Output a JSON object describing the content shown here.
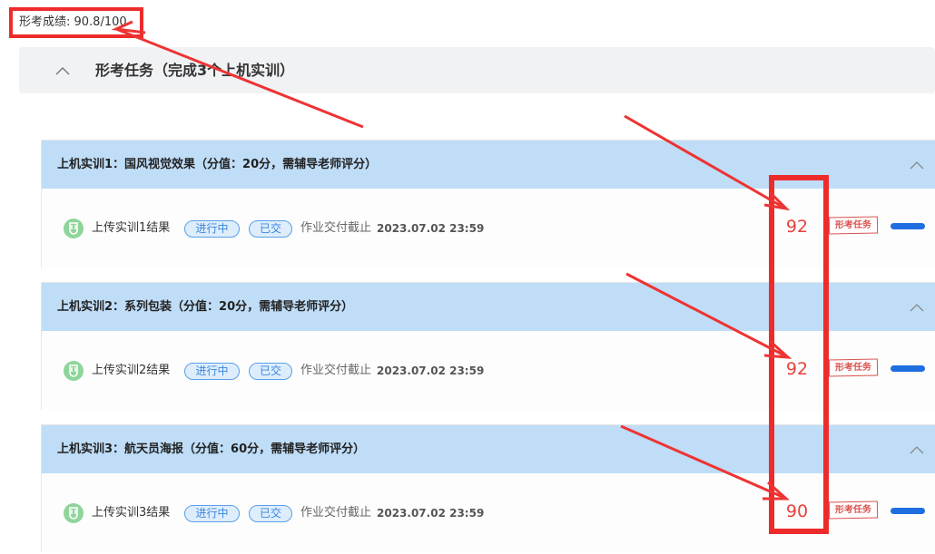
{
  "score": {
    "text": "形考成绩: 90.8/100"
  },
  "section": {
    "title": "形考任务（完成3个上机实训）"
  },
  "tasks": [
    {
      "name": "上机实训1：国风视觉效果（分值：20分，需辅导老师评分）",
      "upload_label": "上传实训1结果",
      "status": "进行中",
      "submitted": "已交",
      "deadline_label": "作业交付截止",
      "deadline": "2023.07.02 23:59",
      "grade": "92",
      "stamp": "形考任务"
    },
    {
      "name": "上机实训2：系列包装（分值：20分，需辅导老师评分）",
      "upload_label": "上传实训2结果",
      "status": "进行中",
      "submitted": "已交",
      "deadline_label": "作业交付截止",
      "deadline": "2023.07.02 23:59",
      "grade": "92",
      "stamp": "形考任务"
    },
    {
      "name": "上机实训3：航天员海报（分值：60分，需辅导老师评分）",
      "upload_label": "上传实训3结果",
      "status": "进行中",
      "submitted": "已交",
      "deadline_label": "作业交付截止",
      "deadline": "2023.07.02 23:59",
      "grade": "90",
      "stamp": "形考任务"
    }
  ],
  "colors": {
    "annotation_red": "#ee2b2b",
    "task_header_bg": "#bfddf7",
    "tag_blue": "#3a86e0",
    "grade_red": "#e8413b",
    "bar_blue": "#1e6ee0"
  },
  "icons": [
    "chevron-up-icon",
    "upload-icon"
  ]
}
